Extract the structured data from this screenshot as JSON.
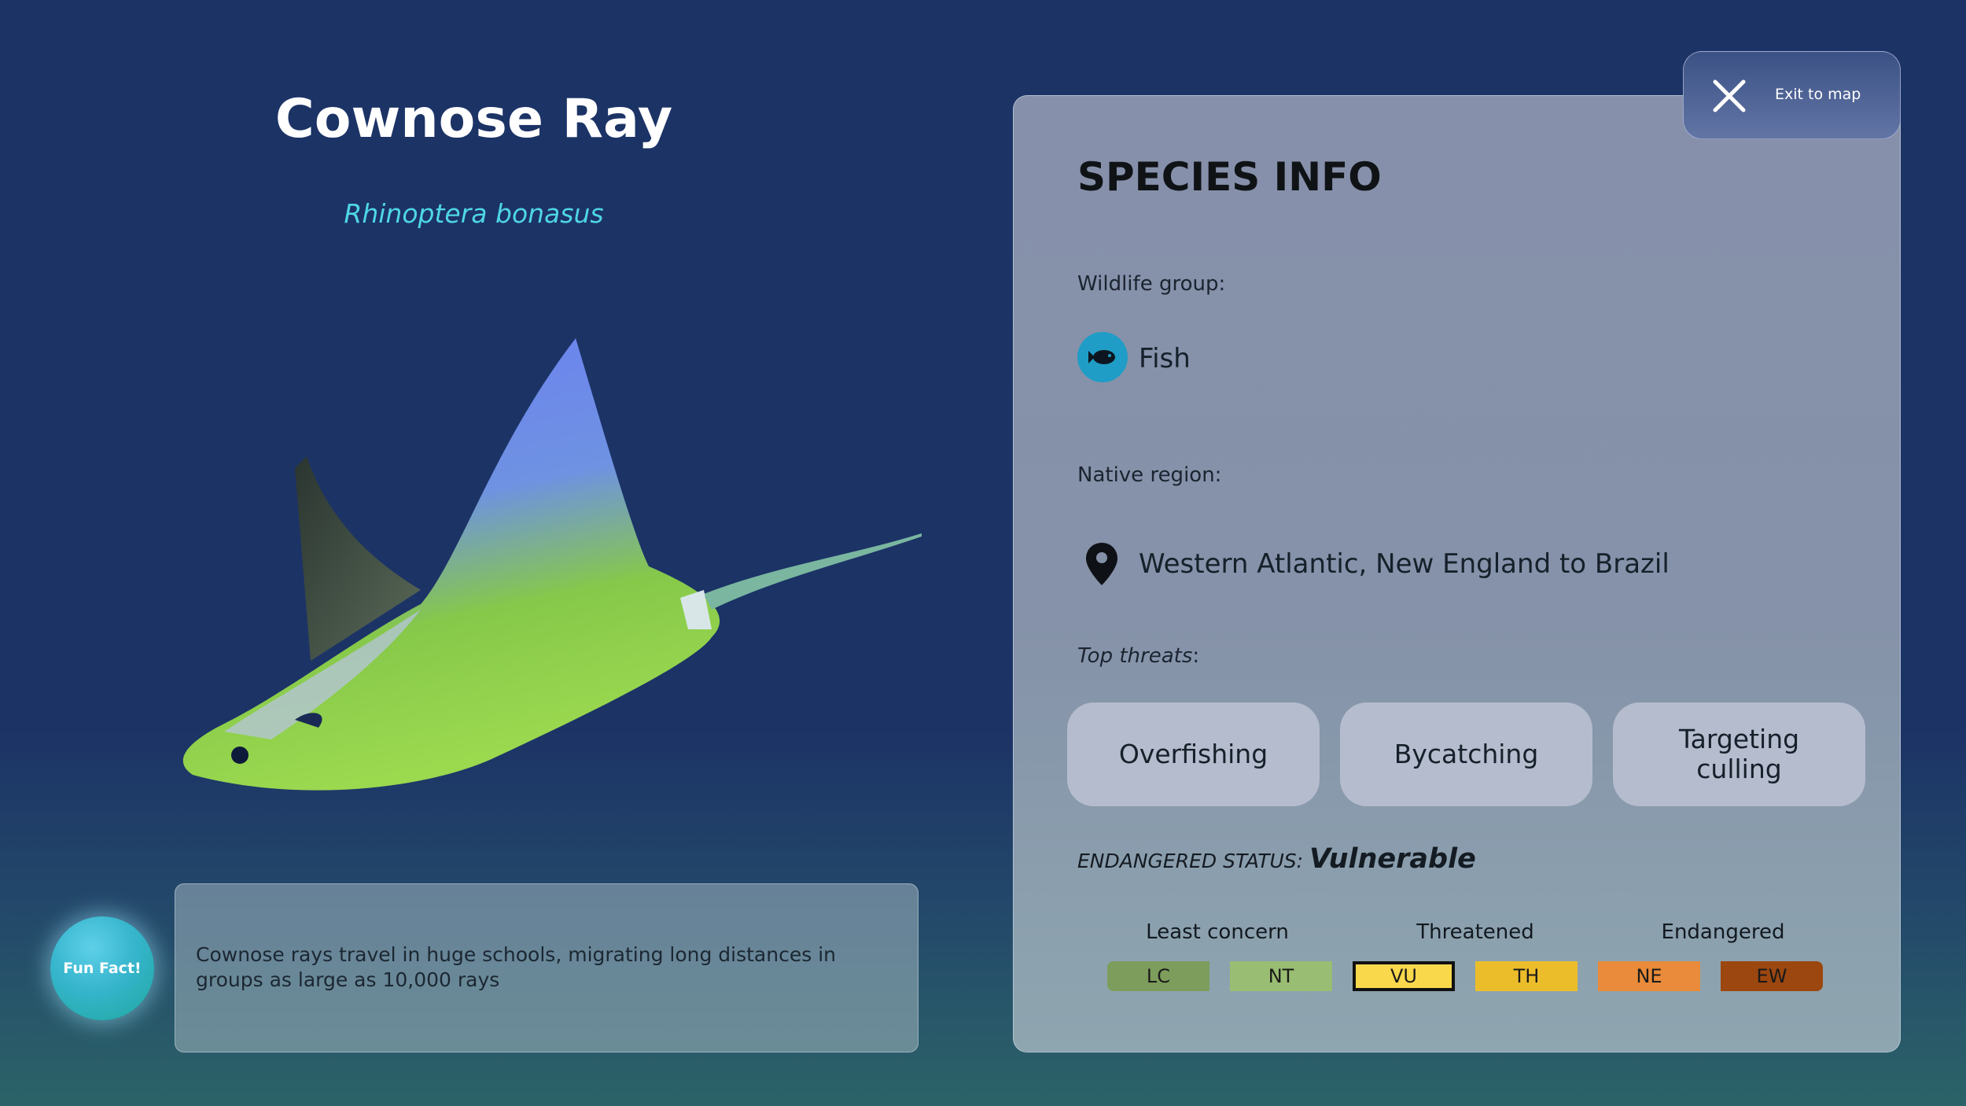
{
  "species": {
    "common_name": "Cownose Ray",
    "scientific_name": "Rhinoptera bonasus"
  },
  "fun_fact": {
    "button_label": "Fun Fact!",
    "text": "Cownose rays travel in huge schools, migrating long distances in groups as large as 10,000 rays"
  },
  "header": {
    "exit_label": "Exit to map",
    "exit_icon": "close-icon"
  },
  "info": {
    "heading": "SPECIES INFO",
    "wildlife_group_label": "Wildlife group:",
    "wildlife_group": "Fish",
    "wildlife_icon": "fish-icon",
    "native_region_label": "Native region:",
    "native_region": "Western Atlantic, New England to Brazil",
    "region_icon": "map-pin-icon",
    "threats_label_main": "Top threats",
    "threats_label_colon": ":",
    "threats": [
      "Overfishing",
      "Bycatching",
      "Targeting culling"
    ]
  },
  "status": {
    "label": "ENDANGERED STATUS:",
    "value": "Vulnerable",
    "groups": [
      "Least concern",
      "Threatened",
      "Endangered"
    ],
    "levels": [
      {
        "code": "LC",
        "color": "#7d9d5c"
      },
      {
        "code": "NT",
        "color": "#99bd72"
      },
      {
        "code": "VU",
        "color": "#fad84c"
      },
      {
        "code": "TH",
        "color": "#ecbd2a"
      },
      {
        "code": "NE",
        "color": "#e98b3a"
      },
      {
        "code": "EW",
        "color": "#9c4710"
      }
    ],
    "selected": "VU"
  },
  "colors": {
    "background": "#1c3366",
    "accent_cyan": "#4fd6e6",
    "fish_badge": "#1f9dc6"
  }
}
